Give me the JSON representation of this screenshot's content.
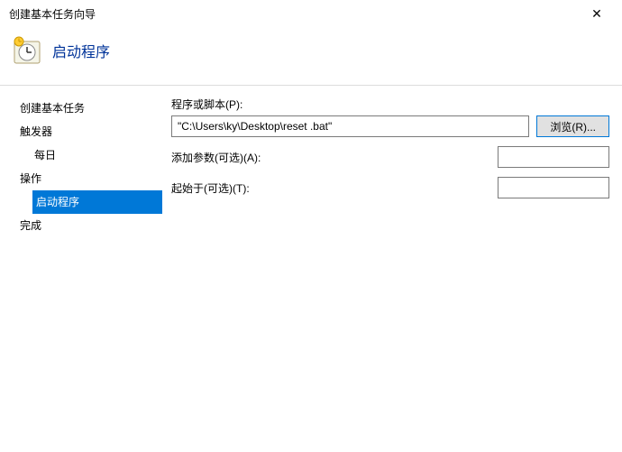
{
  "window": {
    "title": "创建基本任务向导",
    "close_glyph": "✕"
  },
  "header": {
    "page_title": "启动程序"
  },
  "sidebar": {
    "create_basic_task": "创建基本任务",
    "trigger": "触发器",
    "trigger_daily": "每日",
    "action": "操作",
    "action_start_program": "启动程序",
    "finish": "完成"
  },
  "form": {
    "program_label": "程序或脚本(P):",
    "program_value": "\"C:\\Users\\ky\\Desktop\\reset .bat\"",
    "browse_label": "浏览(R)...",
    "args_label": "添加参数(可选)(A):",
    "args_value": "",
    "start_in_label": "起始于(可选)(T):",
    "start_in_value": ""
  }
}
